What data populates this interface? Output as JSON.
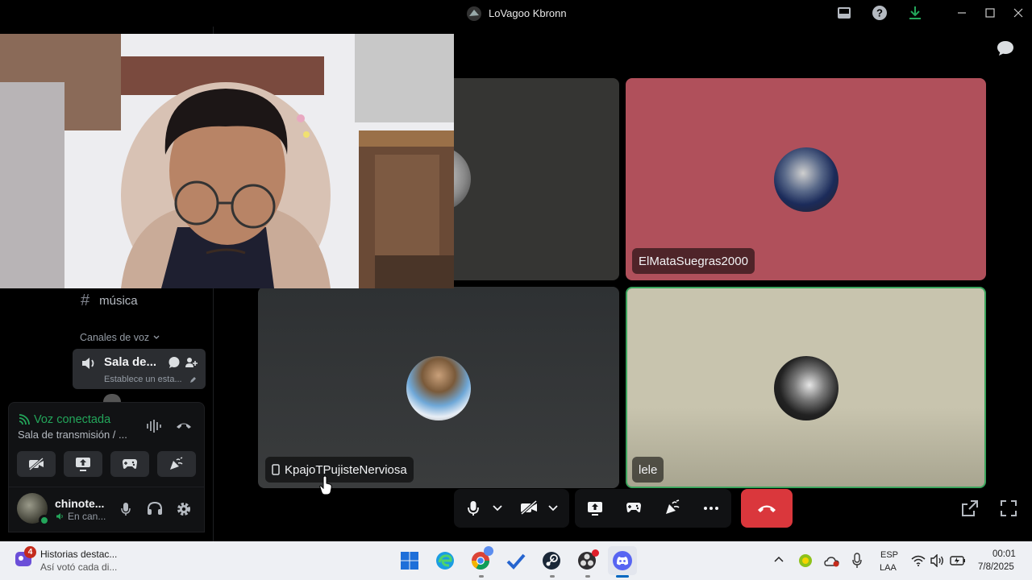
{
  "window": {
    "title": "LoVagoo Kbronn"
  },
  "sidebar": {
    "text_channel": {
      "hash": "#",
      "name": "música"
    },
    "voice_header": "Canales de voz",
    "voice_channel": {
      "name": "Sala de...",
      "status": "Establece un esta..."
    },
    "voice_panel": {
      "status": "Voz conectada",
      "channel": "Sala de transmisión / ..."
    },
    "user": {
      "name": "chinote...",
      "status": "En can..."
    }
  },
  "participants": [
    {
      "name": "ElMataSuegras2000"
    },
    {
      "name": "KpajoTPujisteNerviosa"
    },
    {
      "name": "lele"
    }
  ],
  "taskbar": {
    "notification": {
      "badge": "4",
      "title": "Historias destac...",
      "subtitle": "Así votó cada di..."
    },
    "lang": {
      "line1": "ESP",
      "line2": "LAA"
    },
    "clock": {
      "time": "00:01",
      "date": "7/8/2025"
    }
  },
  "colors": {
    "discord_green": "#23a55a",
    "hangup_red": "#da373c",
    "tile_red": "#b0505b",
    "tile_beige": "#c8c4ae",
    "speaking_border": "#3ba55d"
  }
}
